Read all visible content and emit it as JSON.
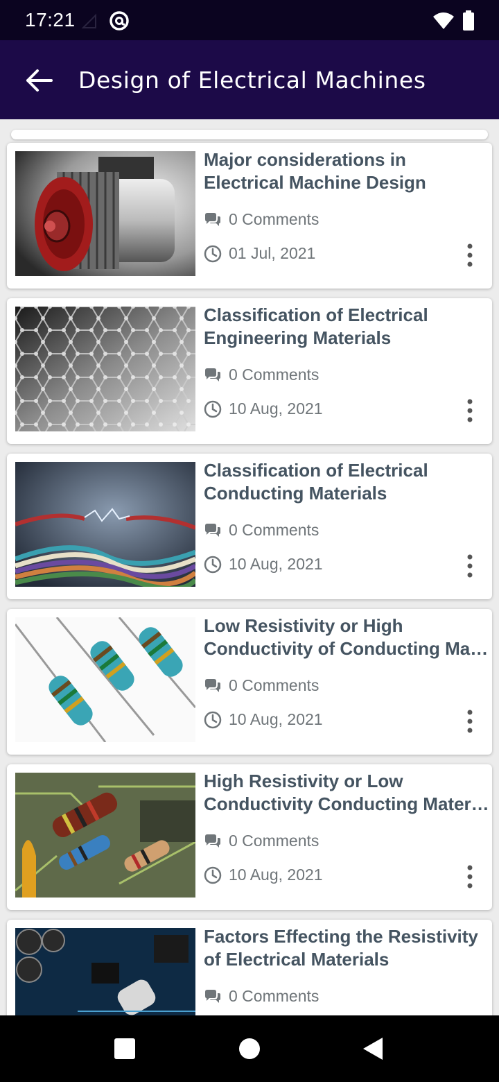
{
  "status": {
    "time": "17:21"
  },
  "appbar": {
    "title": "Design of Electrical Machines"
  },
  "articles": [
    {
      "title_l1": "Major considerations in",
      "title_l2": "Electrical Machine Design",
      "comments": "0 Comments",
      "date": "01 Jul, 2021",
      "thumb": "motor-image"
    },
    {
      "title_l1": "Classification of Electrical",
      "title_l2": "Engineering Materials",
      "comments": "0 Comments",
      "date": "10 Aug, 2021",
      "thumb": "graphene-image"
    },
    {
      "title_l1": "Classification of Electrical",
      "title_l2": "Conducting Materials",
      "comments": "0 Comments",
      "date": "10 Aug, 2021",
      "thumb": "wires-image"
    },
    {
      "title_l1": "Low Resistivity or High",
      "title_l2": "Conductivity of Conducting Materials",
      "comments": "0 Comments",
      "date": "10 Aug, 2021",
      "thumb": "resistors-image"
    },
    {
      "title_l1": "High Resistivity or Low",
      "title_l2": "Conductivity Conducting Materials",
      "comments": "0 Comments",
      "date": "10 Aug, 2021",
      "thumb": "circuit-resistors-image"
    },
    {
      "title_l1": "Factors Effecting the Resistivity",
      "title_l2": "of Electrical Materials",
      "comments": "0 Comments",
      "date": "",
      "thumb": "circuit-board-image"
    }
  ],
  "colors": {
    "statusbar": "#0b0420",
    "appbar": "#1c0a48",
    "title_text": "#455461",
    "meta_text": "#6f7579"
  }
}
